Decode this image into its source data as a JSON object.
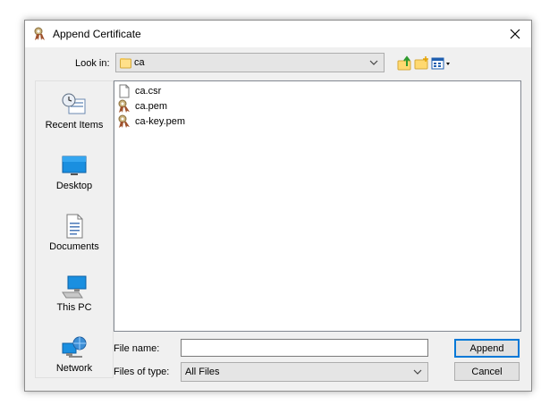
{
  "window": {
    "title": "Append Certificate"
  },
  "look_in": {
    "label": "Look in:",
    "value": "ca"
  },
  "toolbar": {
    "up_icon": "up-folder-icon",
    "new_folder_icon": "new-folder-icon",
    "view_icon": "view-menu-icon"
  },
  "places": [
    {
      "label": "Recent Items",
      "icon": "recent-items-icon"
    },
    {
      "label": "Desktop",
      "icon": "desktop-icon"
    },
    {
      "label": "Documents",
      "icon": "documents-icon"
    },
    {
      "label": "This PC",
      "icon": "this-pc-icon"
    },
    {
      "label": "Network",
      "icon": "network-icon"
    }
  ],
  "files": [
    {
      "name": "ca.csr",
      "icon": "blank-file-icon"
    },
    {
      "name": "ca.pem",
      "icon": "certificate-file-icon"
    },
    {
      "name": "ca-key.pem",
      "icon": "certificate-file-icon"
    }
  ],
  "file_name": {
    "label": "File name:",
    "value": ""
  },
  "files_of_type": {
    "label": "Files of type:",
    "value": "All Files"
  },
  "buttons": {
    "append": "Append",
    "cancel": "Cancel"
  },
  "colors": {
    "accent": "#0078d7",
    "window_bg": "#f0f0f0"
  }
}
